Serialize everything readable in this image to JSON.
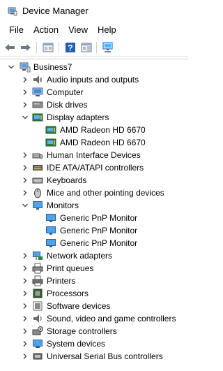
{
  "window": {
    "title": "Device Manager",
    "top_stub": "Business7"
  },
  "menu": {
    "items": [
      "File",
      "Action",
      "View",
      "Help"
    ]
  },
  "toolbar": {
    "buttons": [
      "back-arrow-icon",
      "forward-arrow-icon",
      "properties-icon",
      "help-icon",
      "show-hide-console-tree-icon",
      "scan-hardware-icon"
    ]
  },
  "tree": {
    "root": "Business7",
    "items": [
      {
        "label": "Audio inputs and outputs",
        "expanded": false,
        "icon": "speaker-icon"
      },
      {
        "label": "Computer",
        "expanded": false,
        "icon": "computer-icon"
      },
      {
        "label": "Disk drives",
        "expanded": false,
        "icon": "disk-drive-icon"
      },
      {
        "label": "Display adapters",
        "expanded": true,
        "icon": "display-adapter-icon",
        "children": [
          "AMD Radeon HD 6670",
          "AMD Radeon HD 6670"
        ]
      },
      {
        "label": "Human Interface Devices",
        "expanded": false,
        "icon": "hid-icon"
      },
      {
        "label": "IDE ATA/ATAPI controllers",
        "expanded": false,
        "icon": "ide-controller-icon"
      },
      {
        "label": "Keyboards",
        "expanded": false,
        "icon": "keyboard-icon"
      },
      {
        "label": "Mice and other pointing devices",
        "expanded": false,
        "icon": "mouse-icon"
      },
      {
        "label": "Monitors",
        "expanded": true,
        "icon": "monitor-icon",
        "children": [
          "Generic PnP Monitor",
          "Generic PnP Monitor",
          "Generic PnP Monitor"
        ]
      },
      {
        "label": "Network adapters",
        "expanded": false,
        "icon": "network-adapter-icon"
      },
      {
        "label": "Print queues",
        "expanded": false,
        "icon": "print-queue-icon"
      },
      {
        "label": "Printers",
        "expanded": false,
        "icon": "printer-icon"
      },
      {
        "label": "Processors",
        "expanded": false,
        "icon": "processor-icon"
      },
      {
        "label": "Software devices",
        "expanded": false,
        "icon": "software-device-icon"
      },
      {
        "label": "Sound, video and game controllers",
        "expanded": false,
        "icon": "sound-controller-icon"
      },
      {
        "label": "Storage controllers",
        "expanded": false,
        "icon": "storage-controller-icon"
      },
      {
        "label": "System devices",
        "expanded": false,
        "icon": "system-device-icon"
      },
      {
        "label": "Universal Serial Bus controllers",
        "expanded": false,
        "icon": "usb-controller-icon"
      }
    ]
  },
  "colors": {
    "accent_blue": "#2e7bcf",
    "chevron": "#404040",
    "separator": "#cfcfcf"
  }
}
